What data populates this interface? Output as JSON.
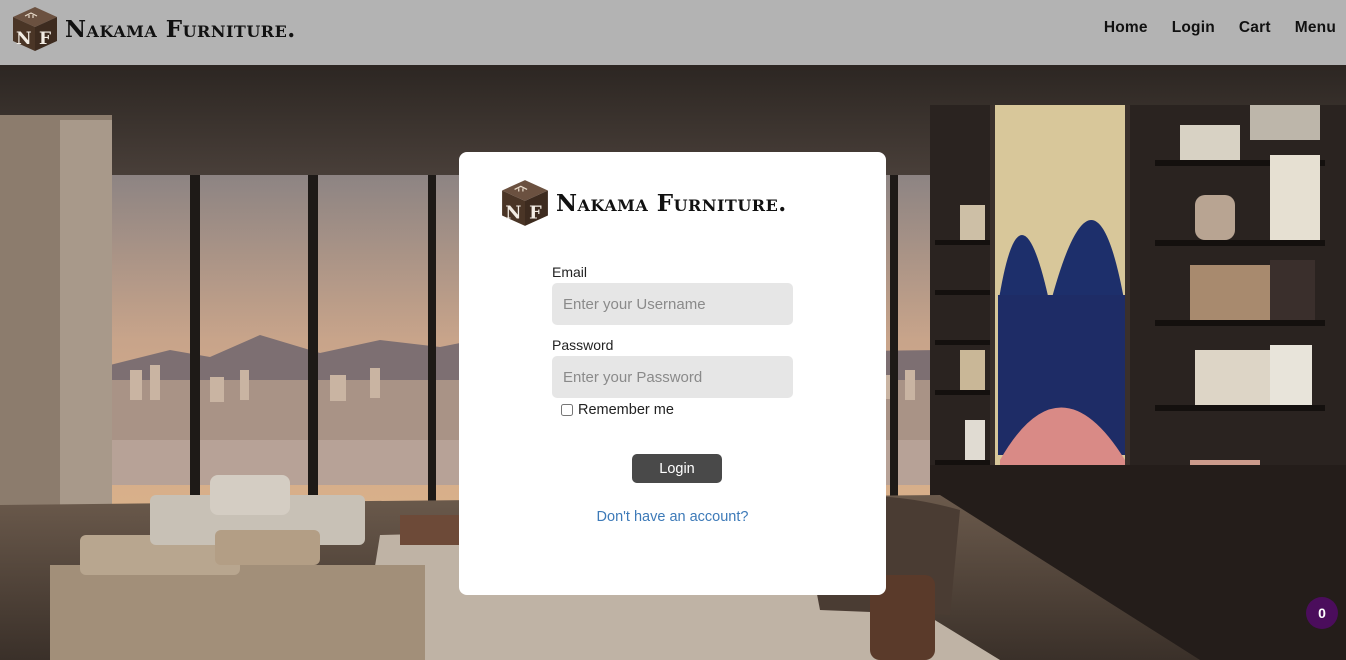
{
  "header": {
    "brand": "Nakama Furniture.",
    "logo_letters": [
      "N",
      "F"
    ],
    "nav": [
      "Home",
      "Login",
      "Cart",
      "Menu"
    ]
  },
  "login_card": {
    "brand": "Nakama Furniture.",
    "email_label": "Email",
    "email_placeholder": "Enter your Username",
    "email_value": "",
    "password_label": "Password",
    "password_placeholder": "Enter your Password",
    "password_value": "",
    "remember_label": "Remember me",
    "remember_checked": false,
    "login_button": "Login",
    "signup_link": "Don't have an account?"
  },
  "cart_badge": {
    "count": "0"
  },
  "colors": {
    "header_bg": "#b3b3b3",
    "logo_brown": "#4a3526",
    "button_bg": "#494949",
    "link": "#3d7ab8",
    "badge": "#4b0d5c"
  },
  "icons": [
    "nakama-cube-logo-icon"
  ]
}
